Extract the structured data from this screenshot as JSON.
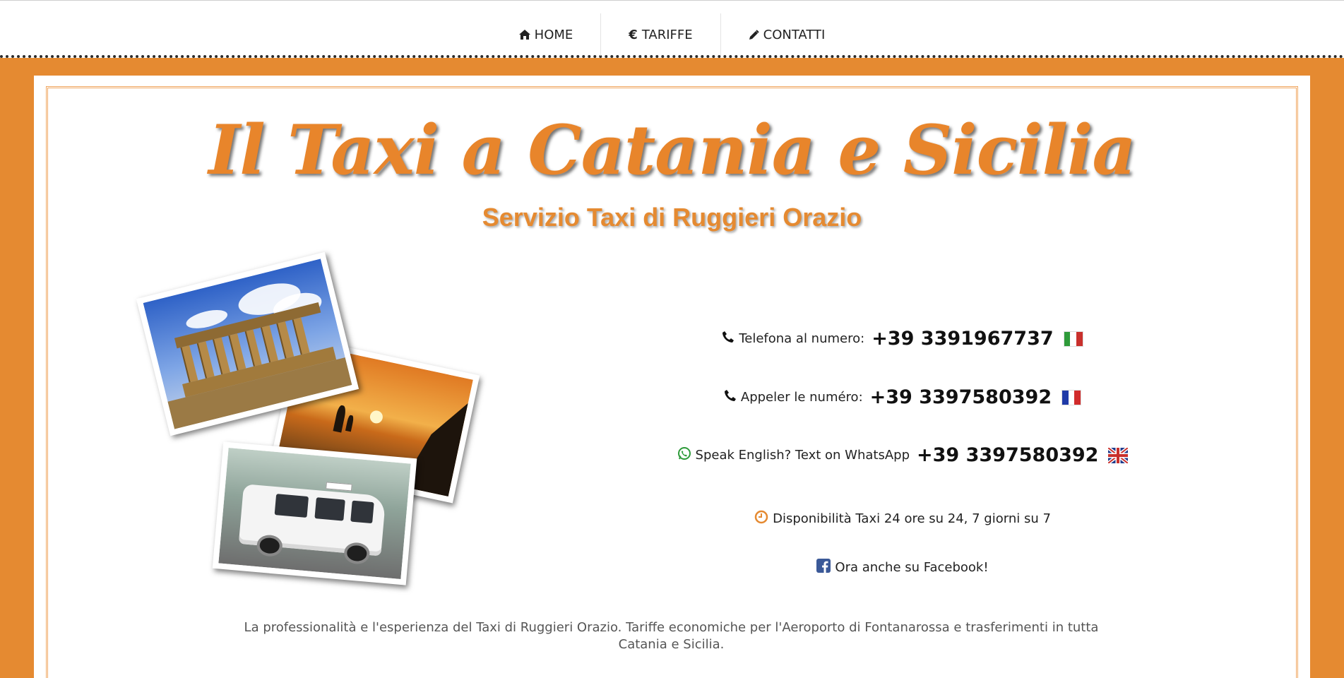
{
  "nav": {
    "items": [
      {
        "label": "HOME",
        "icon": "home-icon"
      },
      {
        "label": "TARIFFE",
        "icon": "euro-icon"
      },
      {
        "label": "CONTATTI",
        "icon": "pencil-icon"
      }
    ]
  },
  "header": {
    "title": "Il Taxi a Catania e Sicilia",
    "subtitle": "Servizio Taxi di Ruggieri Orazio"
  },
  "contacts": {
    "italian": {
      "label": "Telefona al numero:",
      "number": "+39 3391967737",
      "icon": "phone-icon",
      "flag": "italy-flag-icon"
    },
    "french": {
      "label": "Appeler le numéro:",
      "number": "+39 3397580392",
      "icon": "phone-icon",
      "flag": "france-flag-icon"
    },
    "english": {
      "label": "Speak English? Text on WhatsApp",
      "number": "+39 3397580392",
      "icon": "whatsapp-icon",
      "flag": "uk-flag-icon"
    },
    "availability": {
      "label": "Disponibilità Taxi 24 ore su 24, 7 giorni su 7",
      "icon": "clock-icon"
    },
    "facebook": {
      "label": "Ora anche su Facebook!",
      "icon": "facebook-icon"
    }
  },
  "description": "La professionalità e l'esperienza del Taxi di Ruggieri Orazio. Tariffe economiche per l'Aeroporto di Fontanarossa e trasferimenti in tutta Catania e Sicilia.",
  "colors": {
    "accent": "#e58a31",
    "title": "#e8852b",
    "whatsapp": "#2e9b3a",
    "clock": "#e58a31",
    "facebook": "#3b5998"
  }
}
